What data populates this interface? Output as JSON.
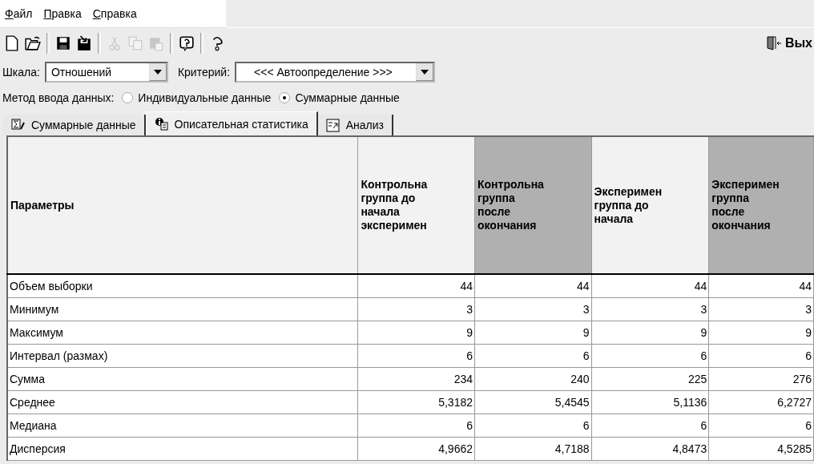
{
  "menu": [
    {
      "label": "Файл"
    },
    {
      "label": "Правка"
    },
    {
      "label": "Справка"
    }
  ],
  "toolbar": [
    {
      "kind": "new",
      "disabled": false
    },
    {
      "kind": "open",
      "disabled": false
    },
    {
      "kind": "sep"
    },
    {
      "kind": "save",
      "disabled": false
    },
    {
      "kind": "saveas",
      "disabled": false
    },
    {
      "kind": "sep"
    },
    {
      "kind": "cut",
      "disabled": true
    },
    {
      "kind": "copy",
      "disabled": true
    },
    {
      "kind": "paste",
      "disabled": true
    },
    {
      "kind": "sep"
    },
    {
      "kind": "help",
      "disabled": false
    },
    {
      "kind": "sep"
    },
    {
      "kind": "whatsthis",
      "disabled": false
    }
  ],
  "exit_button": {
    "label": "Вых"
  },
  "scale": {
    "label": "Шкала:",
    "value": "Отношений"
  },
  "criterion": {
    "label": "Критерий:",
    "value": "<<< Автоопределение >>>"
  },
  "input_method": {
    "label": "Метод ввода данных:",
    "options": [
      {
        "label": "Индивидуальные данные",
        "selected": false
      },
      {
        "label": "Суммарные данные",
        "selected": true
      }
    ]
  },
  "tabs": [
    {
      "label": "Суммарные данные",
      "kind": "sum",
      "selected": false
    },
    {
      "label": "Описательная статистика",
      "kind": "info",
      "selected": true
    },
    {
      "label": "Анализ",
      "kind": "analysis",
      "selected": false
    }
  ],
  "table": {
    "columns": [
      {
        "lines": [
          "Параметры"
        ],
        "shaded": false
      },
      {
        "lines": [
          "Контрольна",
          "группа до",
          "начала",
          "эксперимен"
        ],
        "shaded": false
      },
      {
        "lines": [
          "Контрольна",
          "группа",
          "после",
          "окончания"
        ],
        "shaded": true
      },
      {
        "lines": [
          "Эксперимен",
          "группа до",
          "начала"
        ],
        "shaded": false
      },
      {
        "lines": [
          "Эксперимен",
          "группа",
          "после",
          "окончания"
        ],
        "shaded": true
      }
    ],
    "rows": [
      [
        "Объем выборки",
        "44",
        "44",
        "44",
        "44"
      ],
      [
        "Минимум",
        "3",
        "3",
        "3",
        "3"
      ],
      [
        "Максимум",
        "9",
        "9",
        "9",
        "9"
      ],
      [
        "Интервал (размах)",
        "6",
        "6",
        "6",
        "6"
      ],
      [
        "Сумма",
        "234",
        "240",
        "225",
        "276"
      ],
      [
        "Среднее",
        "5,3182",
        "5,4545",
        "5,1136",
        "6,2727"
      ],
      [
        "Медиана",
        "6",
        "6",
        "6",
        "6"
      ],
      [
        "Дисперсия",
        "4,9662",
        "4,7188",
        "4,8473",
        "4,5285"
      ]
    ]
  }
}
